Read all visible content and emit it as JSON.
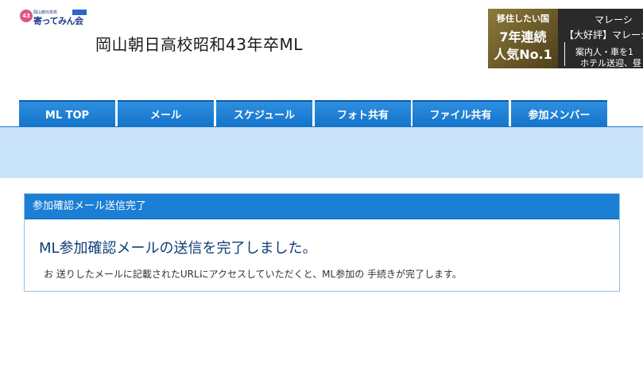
{
  "logo": {
    "badge": "43",
    "small_text": "岡山朝日高校",
    "main_text": "寄ってみん会"
  },
  "site": {
    "title": "岡山朝日高校昭和43年卒ML"
  },
  "ad": {
    "line1": "移住したい国",
    "line2": "7年連続",
    "line3": "人気No.1",
    "right1": "マレーシ",
    "right2": "【大好評】マレーシ",
    "right3": "案内人・車を1",
    "right4": "ホテル送迎、昼"
  },
  "nav": {
    "tabs": [
      {
        "label": "ML TOP"
      },
      {
        "label": "メール"
      },
      {
        "label": "スケジュール"
      },
      {
        "label": "フォト共有"
      },
      {
        "label": "ファイル共有"
      },
      {
        "label": "参加メンバー"
      }
    ]
  },
  "panel": {
    "header": "参加確認メール送信完了",
    "title": "ML参加確認メールの送信を完了しました。",
    "body": "お 送りしたメールに記載されたURLにアクセスしていただくと、ML参加の 手続きが完了します。"
  },
  "colors": {
    "tab_blue": "#1a7fd8",
    "band_light_blue": "#c9e3fb",
    "title_navy": "#0e3e78"
  }
}
